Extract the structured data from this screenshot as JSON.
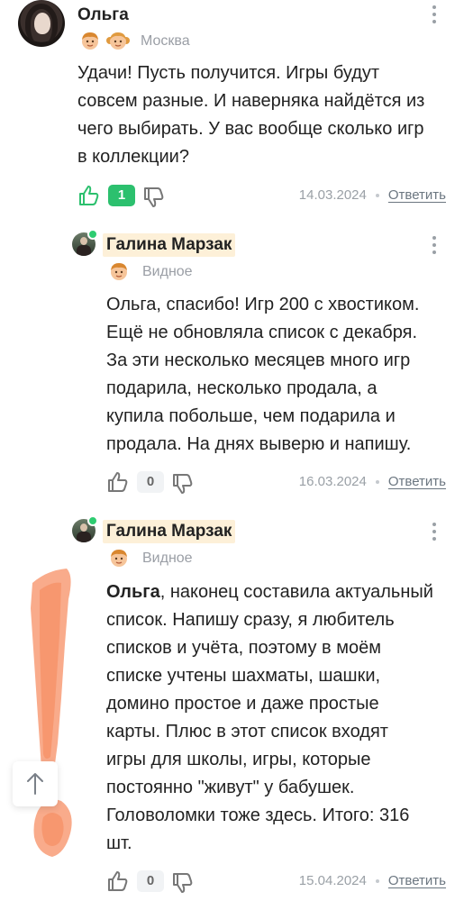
{
  "comments": [
    {
      "author": "Ольга",
      "location": "Москва",
      "badges": [
        "boy-emoji-icon",
        "girl-emoji-icon"
      ],
      "text_lines": [
        "Удачи! Пусть получится. Игры будут",
        "совсем разные. И наверняка найдётся из",
        "чего выбирать. У вас вообще сколько игр",
        "в коллекции?"
      ],
      "likes": "1",
      "date": "14.03.2024",
      "reply_label": "Ответить"
    },
    {
      "author": "Галина Марзак",
      "location": "Видное",
      "badges": [
        "boy-emoji-icon"
      ],
      "online": true,
      "text_lines": [
        "Ольга, спасибо! Игр 200 с хвостиком.",
        "Ещё не обновляла список с декабря.",
        "За эти несколько месяцев много игр",
        "подарила, несколько продала, а",
        "купила побольше, чем подарила и",
        "продала. На днях выверю и напишу."
      ],
      "likes": "0",
      "date": "16.03.2024",
      "reply_label": "Ответить"
    },
    {
      "author": "Галина Марзак",
      "location": "Видное",
      "badges": [
        "boy-emoji-icon"
      ],
      "online": true,
      "mention": "Ольга",
      "text_first_rest": ", наконец составила актуальный",
      "text_lines": [
        "список. Напишу сразу, я любитель",
        "списков и учёта, поэтому в моём",
        "списке учтены шахматы, шашки,",
        "домино простое и даже простые",
        "карты. Плюс в этот список входят",
        "игры для школы, игры, которые",
        "постоянно \"живут\" у бабушек.",
        "Головоломки тоже здесь. Итого: 316",
        "шт."
      ],
      "likes": "0",
      "date": "15.04.2024",
      "reply_label": "Ответить"
    }
  ],
  "colors": {
    "accent_green": "#2cc06e",
    "name_highlight": "#fdf0d8",
    "annotation_orange": "#f7936a"
  },
  "scroll_button": {
    "icon": "arrow-up-icon"
  }
}
